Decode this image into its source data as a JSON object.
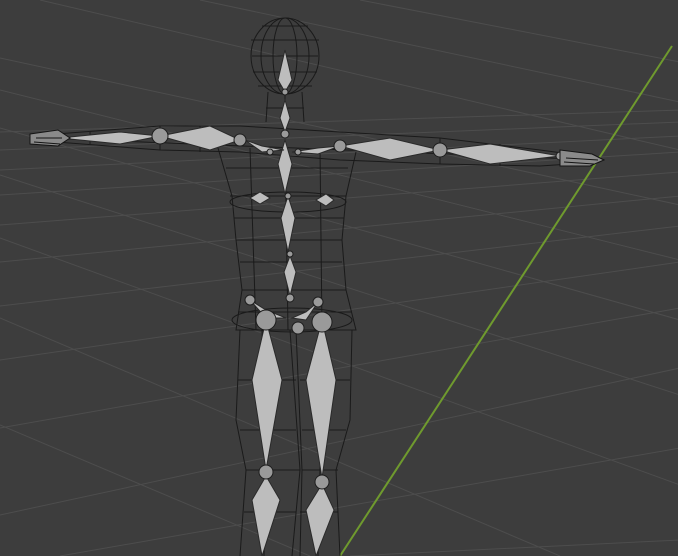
{
  "viewport": {
    "background": "#3d3d3d",
    "grid_color": "#4c4c4c",
    "y_axis_color": "#6f9a2e",
    "mesh_wire_color": "#1a1a1a",
    "bone_fill": "#bdbdbd",
    "bone_edge": "#2a2a2a"
  },
  "scene": {
    "object": "humanoid-rig",
    "mode": "wireframe-with-armature",
    "pose": "T-pose"
  }
}
